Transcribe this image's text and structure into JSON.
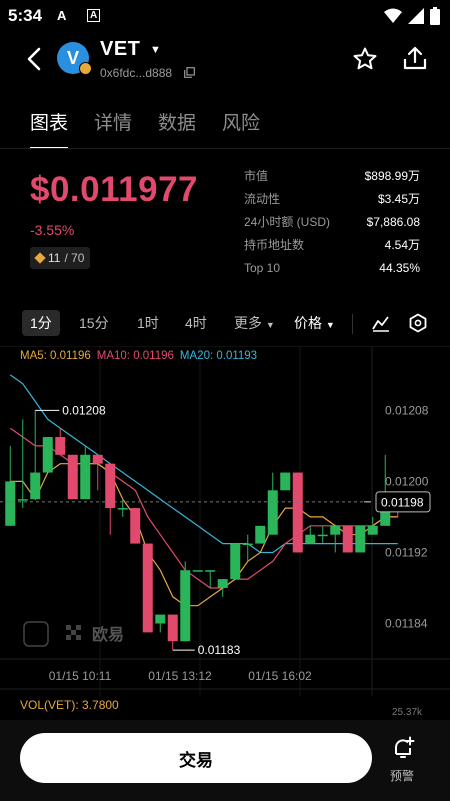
{
  "status_bar": {
    "time": "5:34",
    "app_icons": [
      "A",
      "A"
    ]
  },
  "header": {
    "token_symbol": "VET",
    "token_logo_letter": "V",
    "address": "0x6fdc...d888"
  },
  "tabs": [
    {
      "label": "图表",
      "active": true
    },
    {
      "label": "详情",
      "active": false
    },
    {
      "label": "数据",
      "active": false
    },
    {
      "label": "风险",
      "active": false
    }
  ],
  "price": {
    "value": "$0.011977",
    "change": "-3.55%",
    "rank": "11",
    "rank_total": "/ 70"
  },
  "stats": [
    {
      "label": "市值",
      "value": "$898.99万"
    },
    {
      "label": "流动性",
      "value": "$3.45万"
    },
    {
      "label": "24小时额 (USD)",
      "value": "$7,886.08"
    },
    {
      "label": "持币地址数",
      "value": "4.54万"
    },
    {
      "label": "Top 10",
      "value": "44.35%"
    }
  ],
  "intervals": [
    {
      "label": "1分",
      "active": true
    },
    {
      "label": "15分",
      "active": false
    },
    {
      "label": "1时",
      "active": false
    },
    {
      "label": "4时",
      "active": false
    }
  ],
  "more_label": "更多",
  "price_menu_label": "价格",
  "ma": {
    "ma5": "MA5: 0.01196",
    "ma10": "MA10: 0.01196",
    "ma20": "MA20: 0.01193"
  },
  "chart_data": {
    "type": "candlestick",
    "y_ticks": [
      "0.01208",
      "0.01200",
      "0.01192",
      "0.01184"
    ],
    "y_tick_values": [
      0.01208,
      0.012,
      0.01192,
      0.01184
    ],
    "x_ticks": [
      "01/15 10:11",
      "01/15 13:12",
      "01/15 16:02"
    ],
    "current_price_label": "0.01198",
    "max_label": "0.01208",
    "min_label": "0.01183",
    "candles": [
      {
        "o": 0.01195,
        "c": 0.012,
        "h": 0.01204,
        "l": 0.01195
      },
      {
        "o": 0.01198,
        "c": 0.01198,
        "h": 0.01207,
        "l": 0.01197
      },
      {
        "o": 0.01198,
        "c": 0.01201,
        "h": 0.01208,
        "l": 0.01198
      },
      {
        "o": 0.01201,
        "c": 0.01205,
        "h": 0.01205,
        "l": 0.01201
      },
      {
        "o": 0.01205,
        "c": 0.01203,
        "h": 0.01206,
        "l": 0.01203
      },
      {
        "o": 0.01203,
        "c": 0.01198,
        "h": 0.01203,
        "l": 0.01198
      },
      {
        "o": 0.01198,
        "c": 0.01203,
        "h": 0.01204,
        "l": 0.01198
      },
      {
        "o": 0.01203,
        "c": 0.01202,
        "h": 0.01203,
        "l": 0.01199
      },
      {
        "o": 0.01202,
        "c": 0.01197,
        "h": 0.01202,
        "l": 0.01194
      },
      {
        "o": 0.01197,
        "c": 0.01197,
        "h": 0.01198,
        "l": 0.01196
      },
      {
        "o": 0.01197,
        "c": 0.01193,
        "h": 0.01197,
        "l": 0.01193
      },
      {
        "o": 0.01193,
        "c": 0.01183,
        "h": 0.01193,
        "l": 0.01183
      },
      {
        "o": 0.01184,
        "c": 0.01185,
        "h": 0.01185,
        "l": 0.01183
      },
      {
        "o": 0.01185,
        "c": 0.01182,
        "h": 0.01185,
        "l": 0.01181
      },
      {
        "o": 0.01182,
        "c": 0.0119,
        "h": 0.01191,
        "l": 0.01182
      },
      {
        "o": 0.0119,
        "c": 0.0119,
        "h": 0.0119,
        "l": 0.0119
      },
      {
        "o": 0.0119,
        "c": 0.0119,
        "h": 0.0119,
        "l": 0.01188
      },
      {
        "o": 0.01188,
        "c": 0.01189,
        "h": 0.01189,
        "l": 0.01187
      },
      {
        "o": 0.01189,
        "c": 0.01193,
        "h": 0.01193,
        "l": 0.01189
      },
      {
        "o": 0.01193,
        "c": 0.01193,
        "h": 0.01194,
        "l": 0.01191
      },
      {
        "o": 0.01193,
        "c": 0.01195,
        "h": 0.01195,
        "l": 0.01193
      },
      {
        "o": 0.01194,
        "c": 0.01199,
        "h": 0.01201,
        "l": 0.01194
      },
      {
        "o": 0.01199,
        "c": 0.01201,
        "h": 0.01201,
        "l": 0.01199
      },
      {
        "o": 0.01201,
        "c": 0.01192,
        "h": 0.01201,
        "l": 0.01192
      },
      {
        "o": 0.01193,
        "c": 0.01194,
        "h": 0.01195,
        "l": 0.01193
      },
      {
        "o": 0.01194,
        "c": 0.01194,
        "h": 0.01195,
        "l": 0.01193
      },
      {
        "o": 0.01194,
        "c": 0.01195,
        "h": 0.01195,
        "l": 0.01192
      },
      {
        "o": 0.01195,
        "c": 0.01192,
        "h": 0.01195,
        "l": 0.01192
      },
      {
        "o": 0.01192,
        "c": 0.01195,
        "h": 0.01195,
        "l": 0.01192
      },
      {
        "o": 0.01194,
        "c": 0.01195,
        "h": 0.01196,
        "l": 0.01194
      },
      {
        "o": 0.01195,
        "c": 0.01198,
        "h": 0.01203,
        "l": 0.01195
      },
      {
        "o": 0.01198,
        "c": 0.01197,
        "h": 0.01198,
        "l": 0.01196
      }
    ],
    "ma5": [
      0.012,
      0.012,
      0.01198,
      0.01201,
      0.01202,
      0.01202,
      0.01202,
      0.01202,
      0.01201,
      0.01198,
      0.01196,
      0.01192,
      0.0119,
      0.01187,
      0.01186,
      0.01186,
      0.01187,
      0.01188,
      0.01189,
      0.01191,
      0.01192,
      0.01195,
      0.01197,
      0.01197,
      0.01196,
      0.01196,
      0.01195,
      0.01194,
      0.01194,
      0.01195,
      0.01196,
      0.01196
    ],
    "ma10": [
      0.01206,
      0.01205,
      0.01204,
      0.01204,
      0.01203,
      0.01202,
      0.01202,
      0.01202,
      0.01201,
      0.012,
      0.01199,
      0.01196,
      0.01194,
      0.01192,
      0.0119,
      0.01189,
      0.01188,
      0.01188,
      0.01189,
      0.01189,
      0.0119,
      0.01191,
      0.01193,
      0.01194,
      0.01195,
      0.01195,
      0.01195,
      0.01195,
      0.01195,
      0.01195,
      0.01196,
      0.01196
    ],
    "ma20": [
      0.01212,
      0.01211,
      0.01209,
      0.01207,
      0.01206,
      0.01205,
      0.01204,
      0.01203,
      0.01202,
      0.01201,
      0.012,
      0.01199,
      0.01198,
      0.01197,
      0.01196,
      0.01195,
      0.01194,
      0.01193,
      0.01193,
      0.01193,
      0.01192,
      0.01192,
      0.01193,
      0.01193,
      0.01193,
      0.01193,
      0.01193,
      0.01193,
      0.01193,
      0.01193,
      0.01193,
      0.01193
    ],
    "colors": {
      "up": "#2ab55a",
      "down": "#e24a6d",
      "ma5": "#e6a93a",
      "ma10": "#e24a6d",
      "ma20": "#34b6d8"
    }
  },
  "volume": {
    "label": "VOL(VET): 3.7800",
    "axis_top": "25.37k"
  },
  "bottom": {
    "trade_label": "交易",
    "alert_label": "预警"
  },
  "watermark": "欧易"
}
